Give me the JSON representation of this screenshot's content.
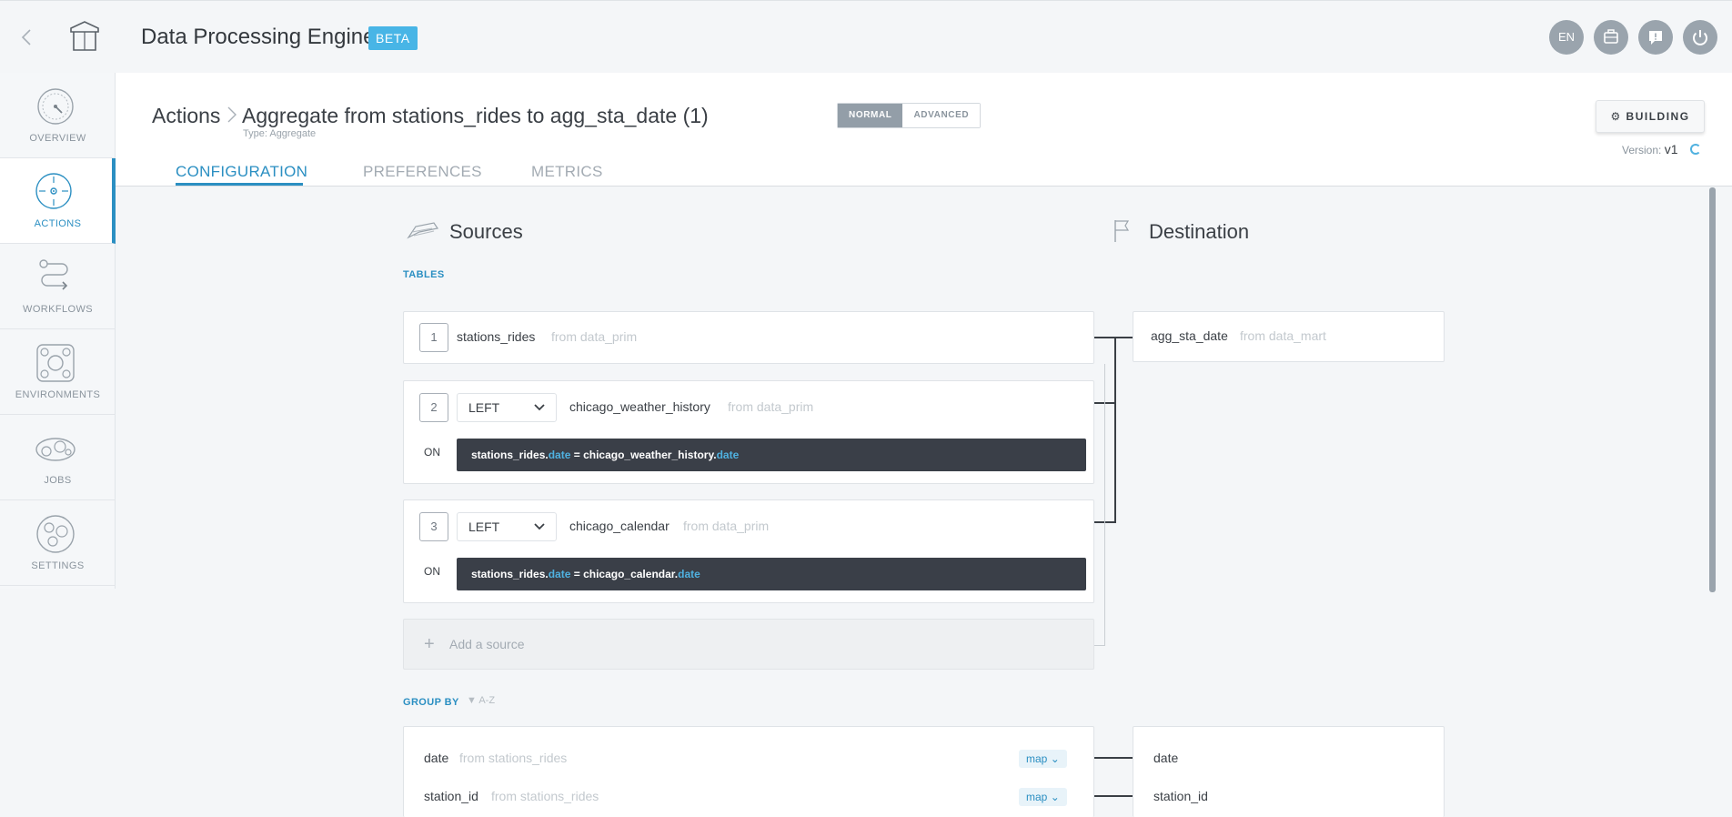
{
  "topbar": {
    "app_title": "Data Processing Engine",
    "beta": "BETA",
    "lang": "EN"
  },
  "sidebar": {
    "items": [
      {
        "label": "OVERVIEW"
      },
      {
        "label": "ACTIONS"
      },
      {
        "label": "WORKFLOWS"
      },
      {
        "label": "ENVIRONMENTS"
      },
      {
        "label": "JOBS"
      },
      {
        "label": "SETTINGS"
      }
    ]
  },
  "header": {
    "crumb_root": "Actions",
    "title": "Aggregate from stations_rides to agg_sta_date (1)",
    "type": "Type: Aggregate",
    "mode_normal": "NORMAL",
    "mode_advanced": "ADVANCED",
    "building": "BUILDING",
    "version_label": "Version:",
    "version_value": "v1",
    "tabs": [
      {
        "label": "CONFIGURATION"
      },
      {
        "label": "PREFERENCES"
      },
      {
        "label": "METRICS"
      }
    ]
  },
  "sources": {
    "title": "Sources",
    "tables_label": "TABLES",
    "tables": [
      {
        "num": "1",
        "name": "stations_rides",
        "from": "from data_prim"
      },
      {
        "num": "2",
        "join": "LEFT",
        "name": "chicago_weather_history",
        "from": "from data_prim",
        "on": "ON",
        "cond_a": "stations_rides.",
        "cond_b": "date",
        "cond_c": " = chicago_weather_history.",
        "cond_d": "date"
      },
      {
        "num": "3",
        "join": "LEFT",
        "name": "chicago_calendar",
        "from": "from data_prim",
        "on": "ON",
        "cond_a": "stations_rides.",
        "cond_b": "date",
        "cond_c": " = chicago_calendar.",
        "cond_d": "date"
      }
    ],
    "add_source": "Add a source"
  },
  "destination": {
    "title": "Destination",
    "name": "agg_sta_date",
    "from": "from data_mart"
  },
  "group_by": {
    "label": "GROUP BY",
    "sort": "A-Z",
    "rows": [
      {
        "name": "date",
        "from": "from stations_rides",
        "map": "map",
        "dest": "date"
      },
      {
        "name": "station_id",
        "from": "from stations_rides",
        "map": "map",
        "dest": "station_id"
      }
    ]
  }
}
